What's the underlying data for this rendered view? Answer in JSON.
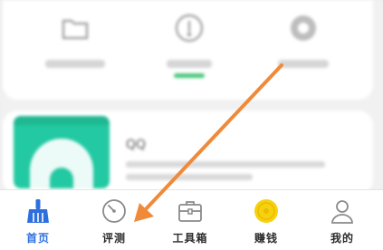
{
  "tools": [
    {
      "label": "",
      "icon": "folder-icon"
    },
    {
      "label": "",
      "icon": "thermometer-icon",
      "has_badge": true
    },
    {
      "label": "",
      "icon": "gear-icon"
    }
  ],
  "banner": {
    "title": "QQ",
    "thumb_color": "#22c9a2"
  },
  "tabbar": {
    "items": [
      {
        "label": "首页",
        "icon": "broom-icon",
        "active": true
      },
      {
        "label": "评测",
        "icon": "gauge-icon"
      },
      {
        "label": "工具箱",
        "icon": "toolbox-icon"
      },
      {
        "label": "赚钱",
        "icon": "coin-icon"
      },
      {
        "label": "我的",
        "icon": "person-icon"
      }
    ]
  },
  "colors": {
    "accent": "#2e6fe0",
    "arrow": "#f08a3a",
    "coin": "#f5d20f",
    "banner": "#22c9a2"
  }
}
